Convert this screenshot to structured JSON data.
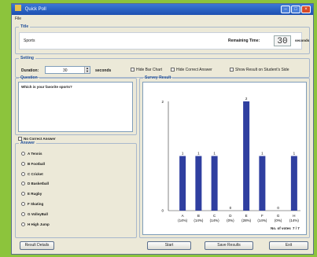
{
  "window": {
    "title": "Quick Poll"
  },
  "menu": {
    "file": "File"
  },
  "title_section": {
    "legend": "Title",
    "value": "Sports",
    "remaining_label": "Remaining Time:",
    "remaining_value": "30",
    "remaining_unit": "seconds"
  },
  "setting": {
    "legend": "Setting",
    "duration_label": "Duration:",
    "duration_value": "30",
    "duration_unit": "seconds",
    "hide_bar_chart": "Hide Bar Chart",
    "hide_correct_answer": "Hide Correct Answer",
    "show_result": "Show Result on Student's Side"
  },
  "question": {
    "legend": "Question",
    "text": "Which is your favorite sports?",
    "no_correct_answer": "No Correct Answer"
  },
  "answer": {
    "legend": "Answer",
    "items": [
      "A  Tennis",
      "B  Football",
      "C  Cricket",
      "D  Basketball",
      "E  Rugby",
      "F  Skating",
      "G  VolleyBall",
      "H  High Jump"
    ]
  },
  "survey": {
    "legend": "Survey Result",
    "votes_label": "No. of votes",
    "votes_value": "7 / 7"
  },
  "chart_data": {
    "type": "bar",
    "categories": [
      "A",
      "B",
      "C",
      "D",
      "E",
      "F",
      "G",
      "H"
    ],
    "percent_labels": [
      "(14%)",
      "(14%)",
      "(14%)",
      "(0%)",
      "(28%)",
      "(14%)",
      "(0%)",
      "(14%)"
    ],
    "values": [
      1,
      1,
      1,
      0,
      2,
      1,
      0,
      1
    ],
    "y_ticks": [
      "2",
      "0"
    ],
    "ylim": [
      0,
      2
    ],
    "bar_color": "#2f3fa0"
  },
  "buttons": {
    "result_details": "Result Details",
    "start": "Start",
    "save_results": "Save Results",
    "exit": "Exit"
  }
}
